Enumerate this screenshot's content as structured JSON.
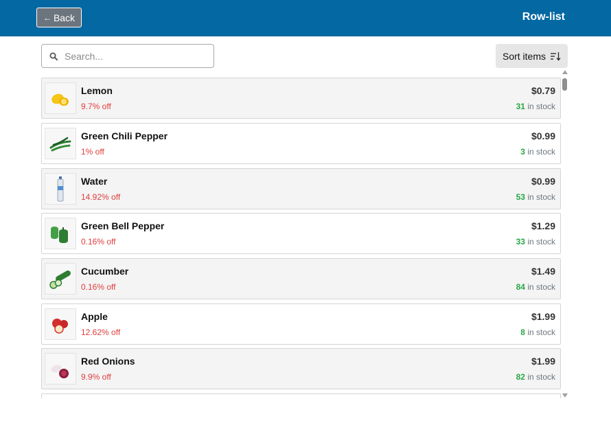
{
  "header": {
    "back_label": "Back",
    "title": "Row-list"
  },
  "search": {
    "placeholder": "Search...",
    "value": ""
  },
  "sort": {
    "label": "Sort items"
  },
  "items": [
    {
      "name": "Lemon",
      "discount": "9.7% off",
      "price": "$0.79",
      "stock": "31",
      "stock_suffix": " in stock",
      "image": "lemon"
    },
    {
      "name": "Green Chili Pepper",
      "discount": "1% off",
      "price": "$0.99",
      "stock": "3",
      "stock_suffix": " in stock",
      "image": "green-chili-pepper"
    },
    {
      "name": "Water",
      "discount": "14.92% off",
      "price": "$0.99",
      "stock": "53",
      "stock_suffix": " in stock",
      "image": "water-bottle"
    },
    {
      "name": "Green Bell Pepper",
      "discount": "0.16% off",
      "price": "$1.29",
      "stock": "33",
      "stock_suffix": " in stock",
      "image": "green-bell-pepper"
    },
    {
      "name": "Cucumber",
      "discount": "0.16% off",
      "price": "$1.49",
      "stock": "84",
      "stock_suffix": " in stock",
      "image": "cucumber"
    },
    {
      "name": "Apple",
      "discount": "12.62% off",
      "price": "$1.99",
      "stock": "8",
      "stock_suffix": " in stock",
      "image": "apple"
    },
    {
      "name": "Red Onions",
      "discount": "9.9% off",
      "price": "$1.99",
      "stock": "82",
      "stock_suffix": " in stock",
      "image": "red-onion"
    }
  ],
  "colors": {
    "header": "#0468a3",
    "discount": "#e03c3c",
    "stock": "#28a745"
  }
}
